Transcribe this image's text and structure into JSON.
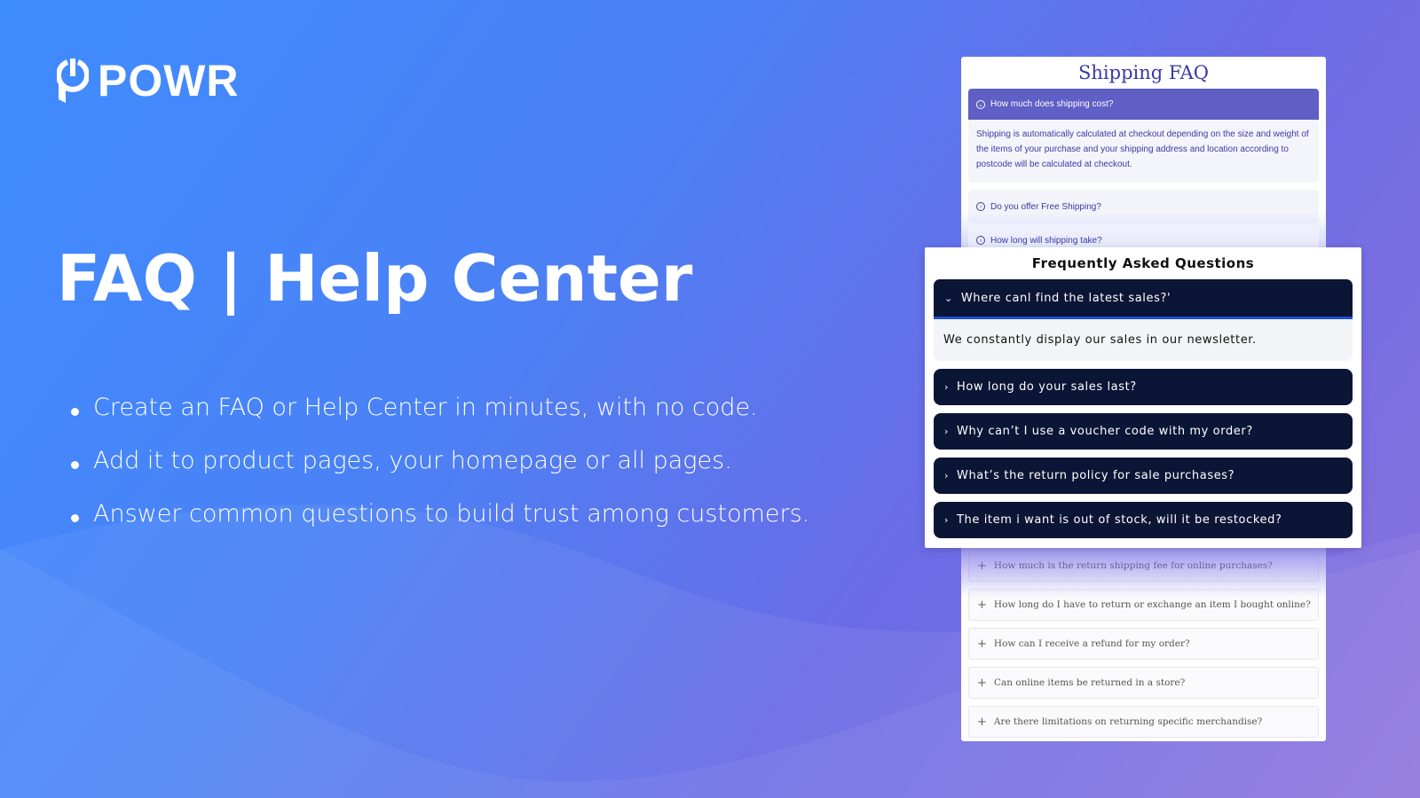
{
  "brand": {
    "name": "POWR",
    "icon": "power-p-logo"
  },
  "hero": {
    "title": "FAQ | Help Center",
    "bullets": [
      "Create an FAQ or Help Center in minutes, with no code.",
      "Add it to product pages, your homepage or all pages.",
      "Answer common questions to build trust among customers."
    ]
  },
  "shipping_faq": {
    "title": "Shipping FAQ",
    "open_question": "How much does shipping cost?",
    "open_answer": "Shipping is automatically calculated at checkout depending on the size and weight of the items of your purchase and your shipping address and location according to postcode will be calculated at checkout.",
    "items": [
      "Do you offer Free Shipping?",
      "How long will shipping take?"
    ],
    "accent": "#5f5fc6"
  },
  "returns_faq": {
    "items": [
      "How much is the return shipping fee for online purchases?",
      "How long do I have to return or exchange an item I bought online?",
      "How can I receive a refund for my order?",
      "Can online items be returned in a store?",
      "Are there limitations on returning specific merchandise?"
    ]
  },
  "main_faq": {
    "title": "Frequently Asked Questions",
    "open_question": "Where canl find the latest sales?'",
    "open_answer": "We constantly display our sales in our newsletter.",
    "items": [
      "How long do your sales last?",
      "Why can’t I use a voucher code with my order?",
      "What’s the return policy for sale purchases?",
      "The item i want is out of stock, will it be restocked?"
    ],
    "accent": "#0b1535"
  }
}
